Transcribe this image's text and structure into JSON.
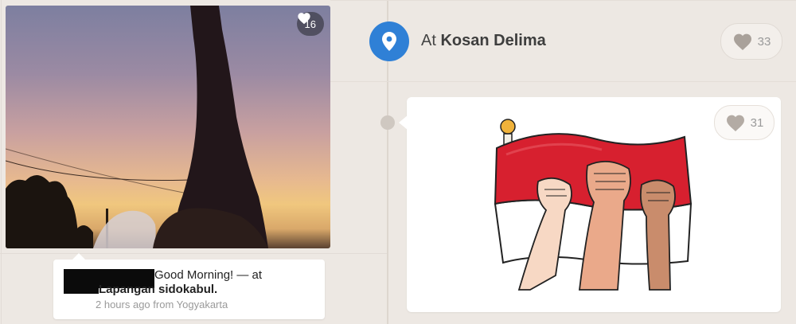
{
  "photo_post": {
    "like_count": "16",
    "caption_text": "Good Morning! — at",
    "caption_place": "Lapangan sidokabul.",
    "meta": "2 hours ago from Yogyakarta"
  },
  "location_post": {
    "prefix": "At",
    "place_name": "Kosan Delima",
    "like_count": "33"
  },
  "image_post": {
    "like_count": "31"
  },
  "icons": {
    "heart": "heart-icon",
    "location": "location-pin-icon"
  },
  "colors": {
    "location_blue": "#2f80d6",
    "flag_red": "#d7202f"
  }
}
